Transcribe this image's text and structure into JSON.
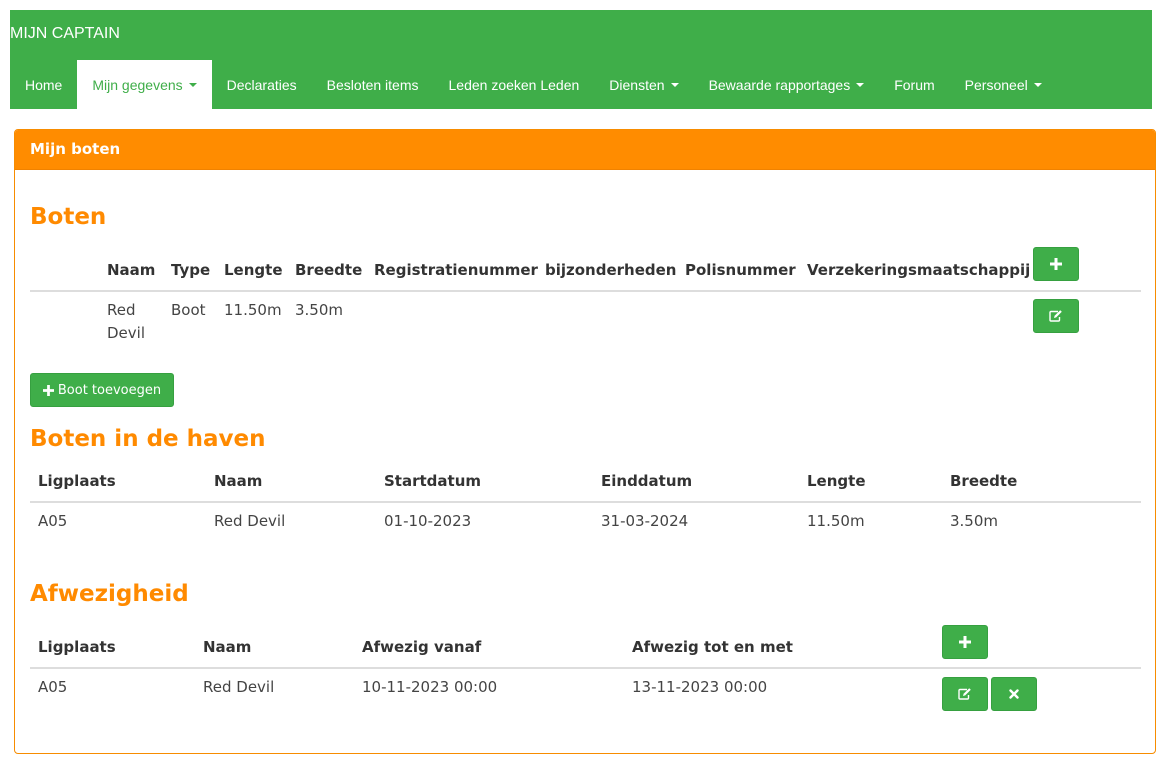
{
  "navbar": {
    "brand": "MIJN CAPTAIN",
    "items": [
      {
        "label": "Home"
      },
      {
        "label": "Mijn gegevens"
      },
      {
        "label": "Declaraties"
      },
      {
        "label": "Besloten items"
      },
      {
        "label": "Leden zoeken Leden"
      },
      {
        "label": "Diensten"
      },
      {
        "label": "Bewaarde rapportages"
      },
      {
        "label": "Forum"
      },
      {
        "label": "Personeel"
      }
    ]
  },
  "panel": {
    "title": "Mijn boten"
  },
  "boten": {
    "heading": "Boten",
    "columns": [
      "Naam",
      "Type",
      "Lengte",
      "Breedte",
      "Registratienummer",
      "bijzonderheden",
      "Polisnummer",
      "Verzekeringsmaatschappij"
    ],
    "rows": [
      {
        "naam_line1": "Red",
        "naam_line2": "Devil",
        "type": "Boot",
        "lengte": "11.50m",
        "breedte": "3.50m"
      }
    ],
    "add_label": "Boot toevoegen"
  },
  "haven": {
    "heading": "Boten in de haven",
    "columns": [
      "Ligplaats",
      "Naam",
      "Startdatum",
      "Einddatum",
      "Lengte",
      "Breedte"
    ],
    "rows": [
      {
        "ligplaats": "A05",
        "naam": "Red Devil",
        "start": "01-10-2023",
        "eind": "31-03-2024",
        "lengte": "11.50m",
        "breedte": "3.50m"
      }
    ]
  },
  "afwezigheid": {
    "heading": "Afwezigheid",
    "columns": [
      "Ligplaats",
      "Naam",
      "Afwezig vanaf",
      "Afwezig tot en met"
    ],
    "rows": [
      {
        "ligplaats": "A05",
        "naam": "Red Devil",
        "vanaf": "10-11-2023 00:00",
        "tot": "13-11-2023 00:00"
      }
    ]
  },
  "icons": {
    "add": "plus-icon",
    "edit": "edit-icon",
    "delete": "close-icon"
  },
  "colors": {
    "navbar": "#3fae49",
    "panel_heading": "#ff8c00",
    "heading_text": "#ff8a00",
    "button": "#3fae49"
  }
}
